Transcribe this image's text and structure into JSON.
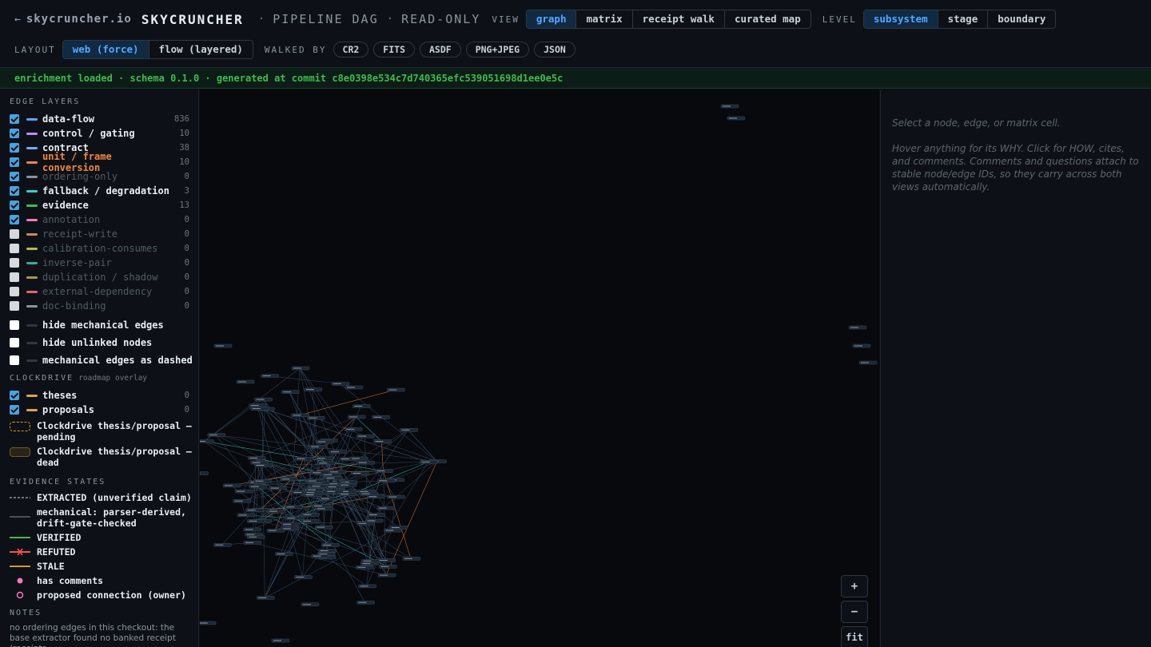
{
  "header": {
    "back_icon": "←",
    "site": "skycruncher.io",
    "brand": "SKYCRUNCHER",
    "sep": "·",
    "title": "PIPELINE DAG",
    "mode": "READ-ONLY",
    "view_label": "VIEW",
    "views": [
      "graph",
      "matrix",
      "receipt walk",
      "curated map"
    ],
    "level_label": "LEVEL",
    "levels": [
      "subsystem",
      "stage",
      "boundary"
    ],
    "layout_label": "LAYOUT",
    "layouts": [
      "web (force)",
      "flow (layered)"
    ],
    "walked_label": "WALKED BY",
    "walked": [
      "CR2",
      "FITS",
      "ASDF",
      "PNG+JPEG",
      "JSON"
    ]
  },
  "banner": "enrichment loaded · schema 0.1.0 · generated at commit c8e0398e534c7d740365efc539051698d1ee0e5c",
  "edge_layers": {
    "title": "EDGE LAYERS",
    "items": [
      {
        "name": "data-flow",
        "count": "836",
        "checked": true,
        "color": "#58a6ff",
        "style": ""
      },
      {
        "name": "control / gating",
        "count": "10",
        "checked": true,
        "color": "#bc8cff",
        "style": ""
      },
      {
        "name": "contract",
        "count": "38",
        "checked": true,
        "color": "#79a8ff",
        "style": ""
      },
      {
        "name": "unit / frame conversion",
        "count": "10",
        "checked": true,
        "color": "#f0883e",
        "style": "orange"
      },
      {
        "name": "ordering-only",
        "count": "0",
        "checked": true,
        "color": "#8b949e",
        "style": "mute"
      },
      {
        "name": "fallback / degradation",
        "count": "3",
        "checked": true,
        "color": "#2dd4bf",
        "style": ""
      },
      {
        "name": "evidence",
        "count": "13",
        "checked": true,
        "color": "#3fb950",
        "style": ""
      },
      {
        "name": "annotation",
        "count": "0",
        "checked": true,
        "color": "#f778ba",
        "style": "mute"
      },
      {
        "name": "receipt-write",
        "count": "0",
        "checked": false,
        "color": "#c98a5a",
        "style": "mute"
      },
      {
        "name": "calibration-consumes",
        "count": "0",
        "checked": false,
        "color": "#b5bd3c",
        "style": "mute"
      },
      {
        "name": "inverse-pair",
        "count": "0",
        "checked": false,
        "color": "#3aa89a",
        "style": "mute"
      },
      {
        "name": "duplication / shadow",
        "count": "0",
        "checked": false,
        "color": "#a89a3a",
        "style": "mute"
      },
      {
        "name": "external-dependency",
        "count": "0",
        "checked": false,
        "color": "#d96a6a",
        "style": "mute"
      },
      {
        "name": "doc-binding",
        "count": "0",
        "checked": false,
        "color": "#8b949e",
        "style": "mute"
      }
    ],
    "toggles": [
      {
        "name": "hide mechanical edges"
      },
      {
        "name": "hide unlinked nodes"
      },
      {
        "name": "mechanical edges as dashed"
      }
    ]
  },
  "clockdrive": {
    "title": "CLOCKDRIVE",
    "subtitle": "roadmap overlay",
    "items": [
      {
        "name": "theses",
        "count": "0"
      },
      {
        "name": "proposals",
        "count": "0"
      }
    ],
    "pending": "Clockdrive thesis/proposal — pending",
    "dead": "Clockdrive thesis/proposal — dead"
  },
  "evidence_states": {
    "title": "EVIDENCE STATES",
    "items": [
      {
        "name": "EXTRACTED (unverified claim)",
        "kind": "dashed",
        "color": "#8b949e"
      },
      {
        "name": "mechanical: parser-derived, drift-gate-checked",
        "kind": "solid",
        "color": "#484f58"
      },
      {
        "name": "VERIFIED",
        "kind": "solid",
        "color": "#3fb950"
      },
      {
        "name": "REFUTED",
        "kind": "refuted",
        "color": "#f85149"
      },
      {
        "name": "STALE",
        "kind": "solid",
        "color": "#d29922"
      },
      {
        "name": "has comments",
        "kind": "dot",
        "color": "#f778ba"
      },
      {
        "name": "proposed connection (owner)",
        "kind": "ring",
        "color": "#f778ba"
      }
    ]
  },
  "notes": {
    "title": "NOTES",
    "text": "no ordering edges in this checkout: the base extractor found no banked receipt (receipts"
  },
  "zoom": {
    "in": "+",
    "out": "−",
    "fit": "fit"
  },
  "right": {
    "line1": "Select a node, edge, or matrix cell.",
    "line2": "Hover anything for its WHY. Click for HOW, cites, and comments. Comments and questions attach to stable node/edge IDs, so they carry across both views automatically."
  }
}
